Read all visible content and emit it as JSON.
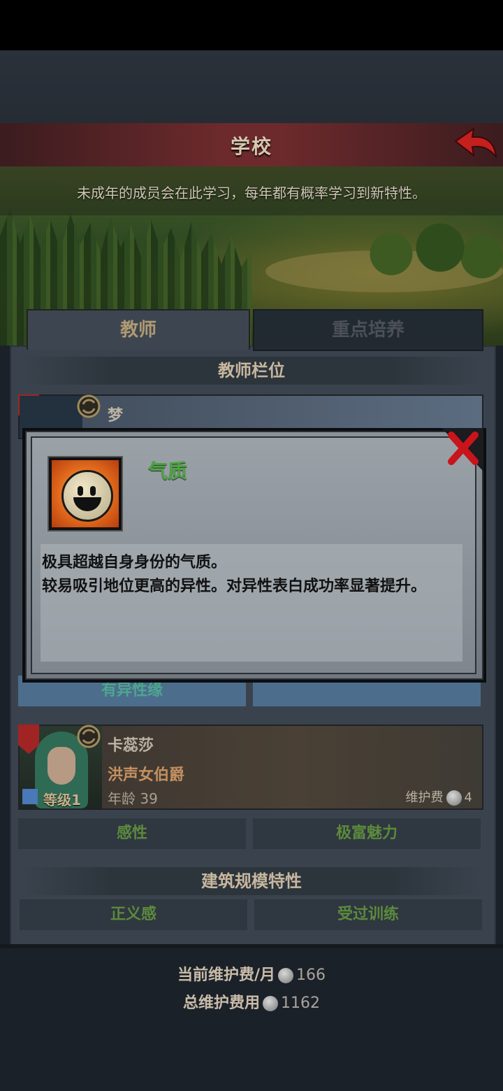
{
  "header": {
    "title": "学校"
  },
  "banner": {
    "text": "未成年的成员会在此学习，每年都有概率学习到新特性。"
  },
  "tabs": [
    {
      "label": "教师"
    },
    {
      "label": "重点培养"
    }
  ],
  "teacher_section": {
    "title": "教师栏位"
  },
  "teacher_1": {
    "name": "梦"
  },
  "teacher_1_trait_left": "有异性缘",
  "teacher_2": {
    "name": "卡蕊莎",
    "title": "洪声女伯爵",
    "level_label": "等级1",
    "age_label": "年龄",
    "age": "39",
    "upkeep_label": "维护费",
    "upkeep": "4",
    "traits": [
      "感性",
      "极富魅力"
    ]
  },
  "building_section": {
    "title": "建筑规模特性",
    "traits": [
      "正义感",
      "受过训练"
    ]
  },
  "footer": {
    "monthly_label": "当前维护费/月",
    "monthly_value": "166",
    "total_label": "总维护费用",
    "total_value": "1162"
  },
  "popup": {
    "trait_name": "气质",
    "desc_line1": "极具超越自身身份的气质。",
    "desc_line2": "较易吸引地位更高的异性。对异性表白成功率显著提升。"
  },
  "colors": {
    "title_bar": "#6d2a2c",
    "trait_green": "#5c8a3c",
    "popup_title": "#4ea63e",
    "close_red": "#c8141a"
  }
}
